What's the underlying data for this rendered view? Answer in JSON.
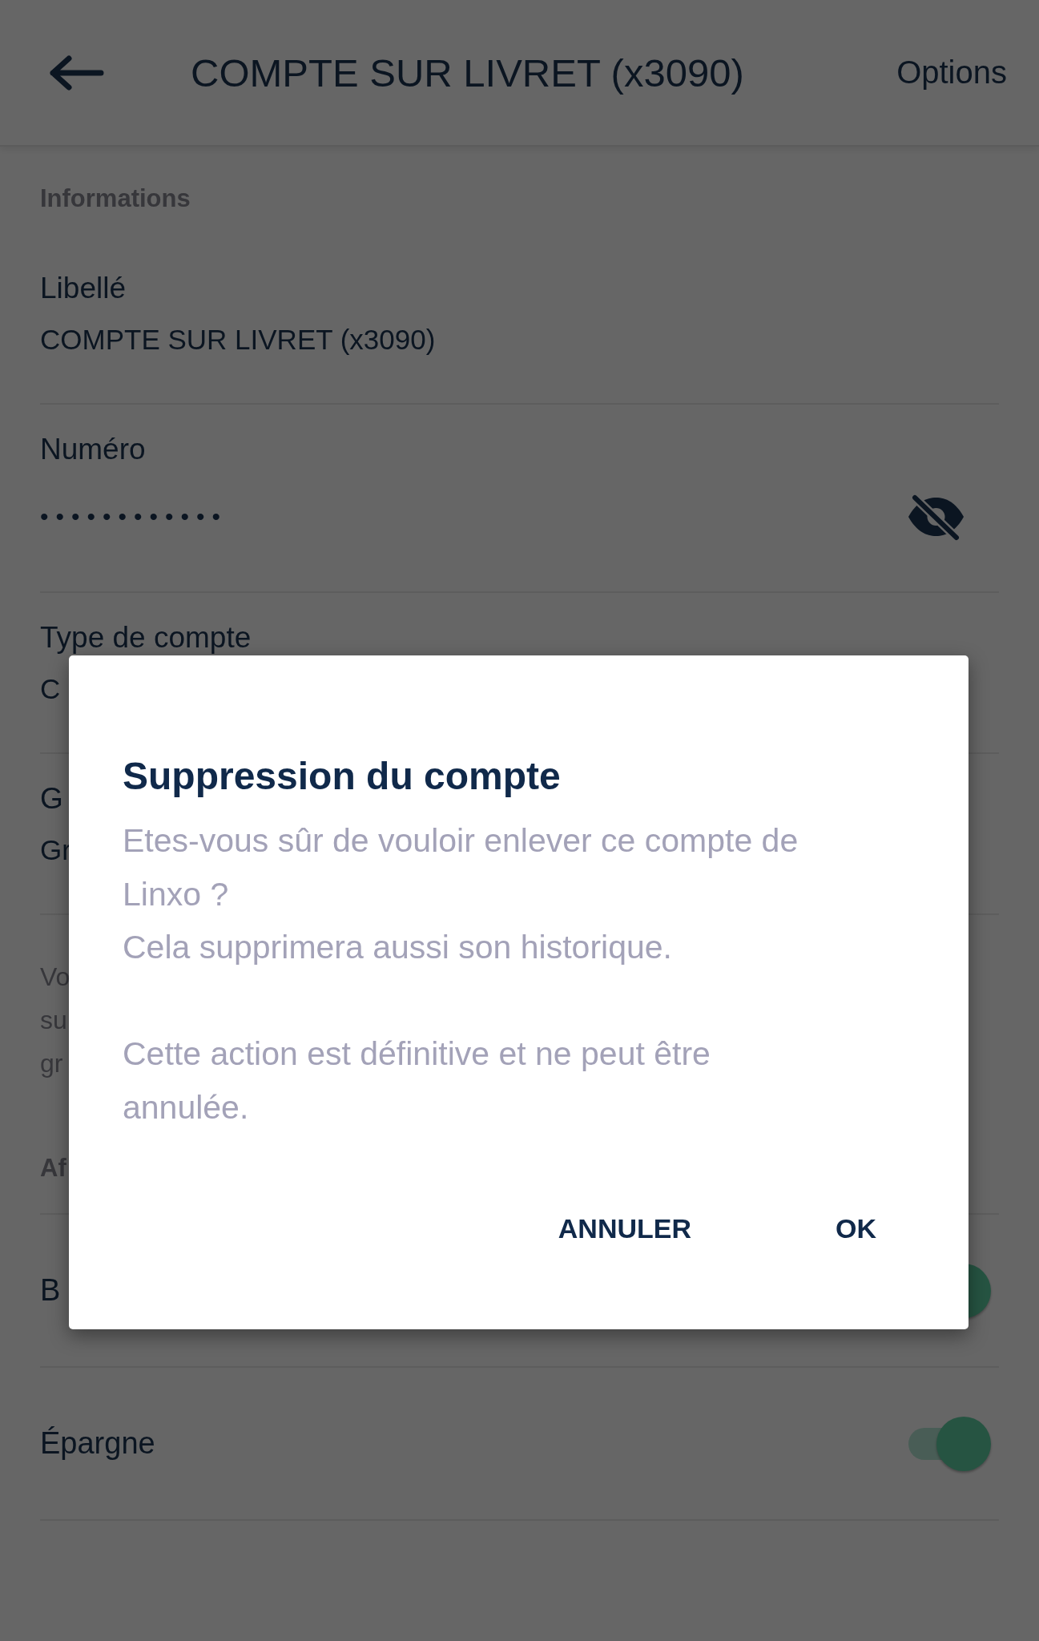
{
  "header": {
    "title": "COMPTE SUR LIVRET (x3090)",
    "action": "Options"
  },
  "content": [
    {
      "kind": "heading",
      "text": "Informations"
    },
    {
      "kind": "field",
      "label": "Libellé",
      "value": "COMPTE SUR LIVRET (x3090)"
    },
    {
      "kind": "secret",
      "label": "Numéro",
      "value": "••••••••••••",
      "revealed": false
    },
    {
      "kind": "field",
      "label": "Type de compte",
      "value": "C"
    },
    {
      "kind": "field",
      "label": "G",
      "value": "Gr"
    },
    {
      "kind": "note",
      "lines": [
        "Vo",
        "su",
        "gr"
      ]
    },
    {
      "kind": "heading",
      "text": "Af"
    },
    {
      "kind": "toggle",
      "label": "B",
      "on": true
    },
    {
      "kind": "toggle",
      "label": "Épargne",
      "on": true
    }
  ],
  "dialog": {
    "title": "Suppression du compte",
    "paragraphs": [
      "Etes-vous sûr de vouloir enlever ce compte de Linxo ?",
      "Cela supprimera aussi son historique.",
      "Cette action est définitive et ne peut être annulée."
    ],
    "buttons": [
      "ANNULER",
      "OK"
    ]
  }
}
